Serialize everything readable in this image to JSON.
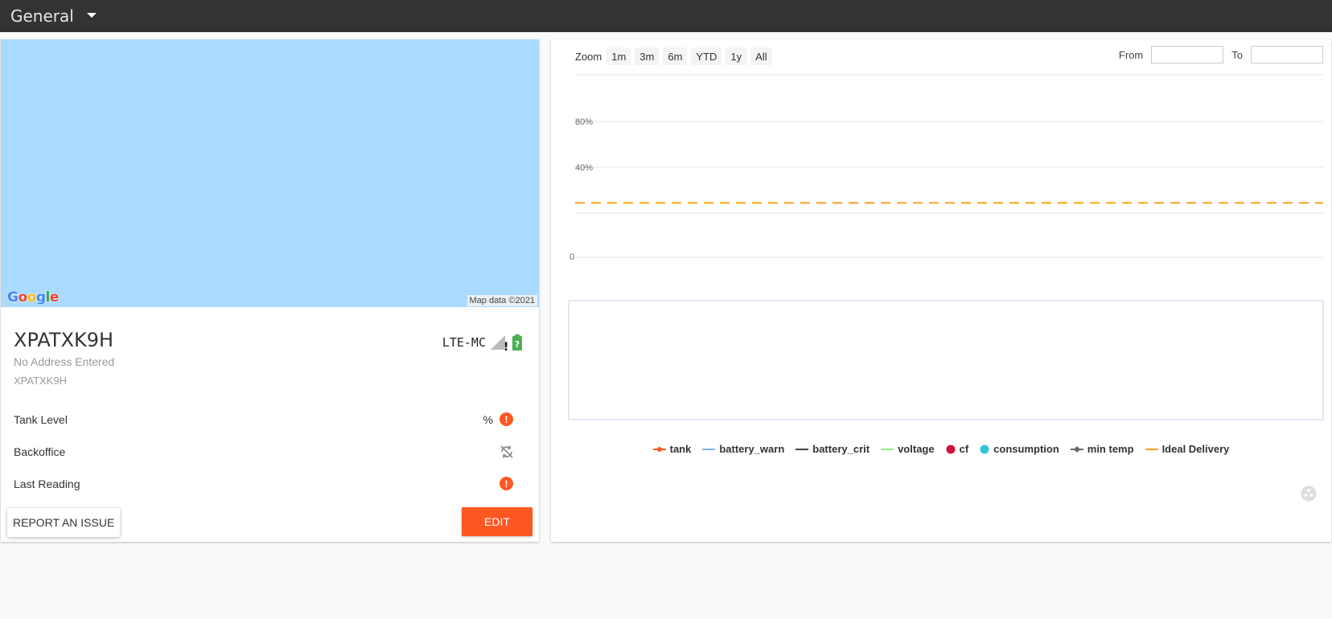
{
  "header": {
    "title": "General"
  },
  "map": {
    "attribution": "Map data ©2021",
    "logo_letters": [
      "G",
      "o",
      "o",
      "g",
      "l",
      "e"
    ]
  },
  "device": {
    "name": "XPATXK9H",
    "address": "No Address Entered",
    "id": "XPATXK9H",
    "network": "LTE-MC",
    "battery_symbol": "?",
    "signal_symbol": "!"
  },
  "rows": [
    {
      "label": "Tank Level",
      "value": "%",
      "status": "alert"
    },
    {
      "label": "Backoffice",
      "value": "",
      "status": "sync-off"
    },
    {
      "label": "Last Reading",
      "value": "",
      "status": "alert"
    }
  ],
  "buttons": {
    "report": "REPORT AN ISSUE",
    "edit": "EDIT"
  },
  "chart_toolbar": {
    "zoom_label": "Zoom",
    "zoom_options": [
      "1m",
      "3m",
      "6m",
      "YTD",
      "1y",
      "All"
    ],
    "from_label": "From",
    "to_label": "To",
    "from_value": "",
    "to_value": ""
  },
  "chart_data": {
    "type": "line",
    "yticks": [
      "80%",
      "40%",
      "0"
    ],
    "series": [
      {
        "name": "Ideal Delivery",
        "values": [
          32,
          32
        ],
        "color": "#f7a11a",
        "dash": true
      }
    ]
  },
  "legend": [
    {
      "name": "tank",
      "color": "#ff5722",
      "marker": "line-dot"
    },
    {
      "name": "battery_warn",
      "color": "#7cb5ec",
      "marker": "line"
    },
    {
      "name": "battery_crit",
      "color": "#434348",
      "marker": "line"
    },
    {
      "name": "voltage",
      "color": "#90ed7d",
      "marker": "line"
    },
    {
      "name": "cf",
      "color": "#d0143d",
      "marker": "dot"
    },
    {
      "name": "consumption",
      "color": "#2fc4d8",
      "marker": "dot"
    },
    {
      "name": "min temp",
      "color": "#666666",
      "marker": "line-diamond"
    },
    {
      "name": "Ideal Delivery",
      "color": "#f7a11a",
      "marker": "line"
    }
  ]
}
